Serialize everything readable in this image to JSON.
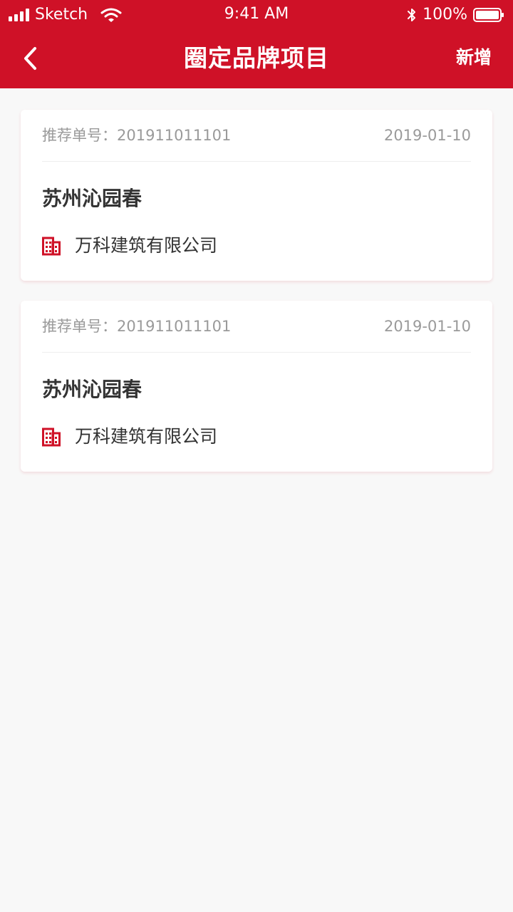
{
  "status_bar": {
    "carrier": "Sketch",
    "time": "9:41 AM",
    "battery": "100%"
  },
  "nav": {
    "title": "圈定品牌项目",
    "action": "新增"
  },
  "cards": [
    {
      "order_label": "推荐单号：",
      "order_no": "201911011101",
      "date": "2019-01-10",
      "title": "苏州沁园春",
      "company": "万科建筑有限公司"
    },
    {
      "order_label": "推荐单号：",
      "order_no": "201911011101",
      "date": "2019-01-10",
      "title": "苏州沁园春",
      "company": "万科建筑有限公司"
    }
  ],
  "colors": {
    "primary": "#CF1127",
    "background": "#F8F8F8",
    "meta_text": "#9A9A9A",
    "main_text": "#333333"
  },
  "icons": {
    "back": "chevron-left-icon",
    "wifi": "wifi-icon",
    "bluetooth": "bluetooth-icon",
    "battery": "battery-icon",
    "company": "building-icon"
  }
}
